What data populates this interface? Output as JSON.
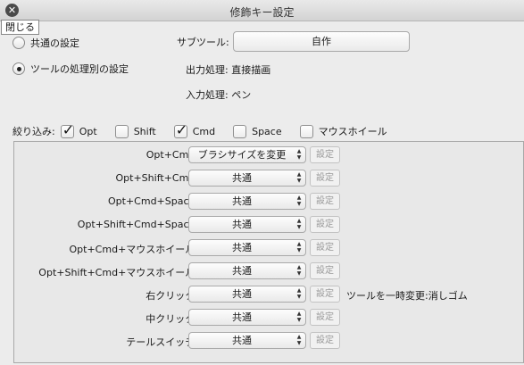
{
  "window": {
    "title": "修飾キー設定",
    "close_tooltip": "閉じる"
  },
  "mode": {
    "options": [
      {
        "label": "共通の設定",
        "selected": false
      },
      {
        "label": "ツールの処理別の設定",
        "selected": true
      }
    ]
  },
  "subtool": {
    "label": "サブツール:",
    "value": "自作"
  },
  "output": {
    "label": "出力処理:",
    "value": "直接描画"
  },
  "input": {
    "label": "入力処理:",
    "value": "ペン"
  },
  "filter": {
    "label": "絞り込み:",
    "items": [
      {
        "label": "Opt",
        "checked": true
      },
      {
        "label": "Shift",
        "checked": false
      },
      {
        "label": "Cmd",
        "checked": true
      },
      {
        "label": "Space",
        "checked": false
      },
      {
        "label": "マウスホイール",
        "checked": false
      }
    ]
  },
  "rows": [
    {
      "label": "Opt+Cmd:",
      "value": "ブラシサイズを変更",
      "button": "設定",
      "note": ""
    },
    {
      "label": "Opt+Shift+Cmd:",
      "value": "共通",
      "button": "設定",
      "note": ""
    },
    {
      "label": "Opt+Cmd+Space:",
      "value": "共通",
      "button": "設定",
      "note": ""
    },
    {
      "label": "Opt+Shift+Cmd+Space:",
      "value": "共通",
      "button": "設定",
      "note": ""
    },
    {
      "label": "Opt+Cmd+マウスホイール:",
      "value": "共通",
      "button": "設定",
      "note": ""
    },
    {
      "label": "Opt+Shift+Cmd+マウスホイール:",
      "value": "共通",
      "button": "設定",
      "note": ""
    },
    {
      "label": "右クリック:",
      "value": "共通",
      "button": "設定",
      "note": "ツールを一時変更:消しゴム"
    },
    {
      "label": "中クリック:",
      "value": "共通",
      "button": "設定",
      "note": ""
    },
    {
      "label": "テールスイッチ:",
      "value": "共通",
      "button": "設定",
      "note": ""
    }
  ]
}
